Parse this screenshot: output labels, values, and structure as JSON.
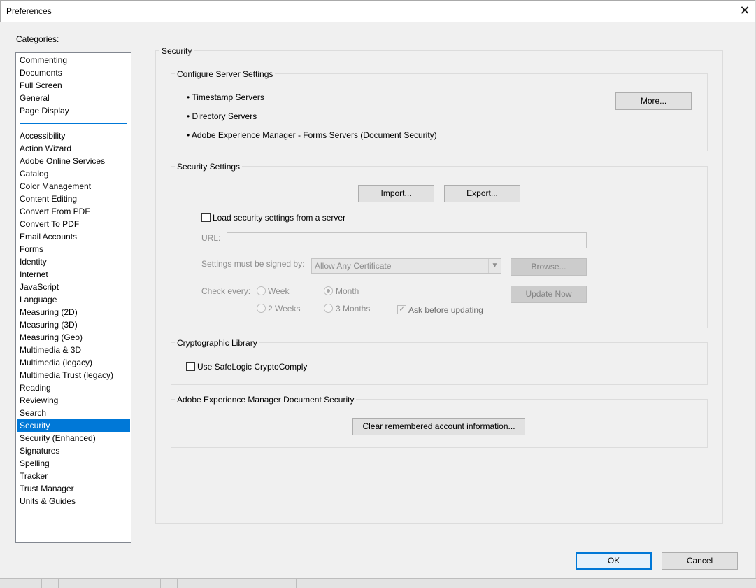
{
  "window": {
    "title": "Preferences",
    "close_glyph": "✕"
  },
  "categories": {
    "label": "Categories:",
    "top_items": [
      "Commenting",
      "Documents",
      "Full Screen",
      "General",
      "Page Display"
    ],
    "items": [
      "Accessibility",
      "Action Wizard",
      "Adobe Online Services",
      "Catalog",
      "Color Management",
      "Content Editing",
      "Convert From PDF",
      "Convert To PDF",
      "Email Accounts",
      "Forms",
      "Identity",
      "Internet",
      "JavaScript",
      "Language",
      "Measuring (2D)",
      "Measuring (3D)",
      "Measuring (Geo)",
      "Multimedia & 3D",
      "Multimedia (legacy)",
      "Multimedia Trust (legacy)",
      "Reading",
      "Reviewing",
      "Search",
      "Security",
      "Security (Enhanced)",
      "Signatures",
      "Spelling",
      "Tracker",
      "Trust Manager",
      "Units & Guides"
    ],
    "selected": "Security"
  },
  "panel": {
    "title": "Security",
    "server": {
      "title": "Configure Server Settings",
      "bullets": [
        "• Timestamp Servers",
        "• Directory Servers",
        "• Adobe Experience Manager - Forms Servers (Document Security)"
      ],
      "more_button": "More..."
    },
    "security": {
      "title": "Security Settings",
      "import_button": "Import...",
      "export_button": "Export...",
      "load_checkbox": "Load security settings from a server",
      "url_label": "URL:",
      "url_value": "",
      "signed_label": "Settings must be signed by:",
      "signed_value": "Allow Any Certificate",
      "browse_button": "Browse...",
      "check_label": "Check every:",
      "radio_week": "Week",
      "radio_month": "Month",
      "radio_2weeks": "2 Weeks",
      "radio_3months": "3 Months",
      "ask_checkbox": "Ask before updating",
      "update_button": "Update Now"
    },
    "crypto": {
      "title": "Cryptographic Library",
      "checkbox": "Use SafeLogic CryptoComply"
    },
    "aem": {
      "title": "Adobe Experience Manager Document Security",
      "clear_button": "Clear remembered account information..."
    }
  },
  "footer": {
    "ok_button": "OK",
    "cancel_button": "Cancel"
  },
  "colors": {
    "selection": "#0078d7",
    "dialog_bg": "#f0f0f0"
  }
}
